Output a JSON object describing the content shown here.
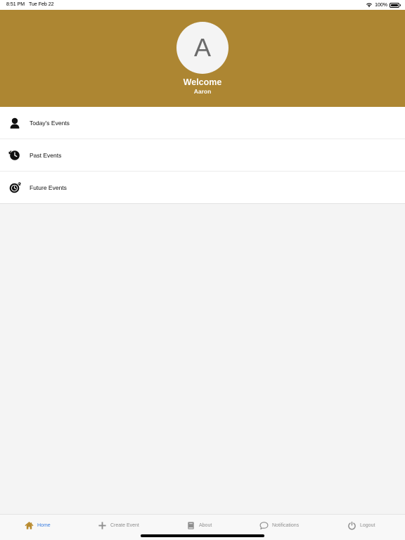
{
  "status_bar": {
    "time": "8:51 PM",
    "date": "Tue Feb 22",
    "battery": "100%",
    "icons": [
      "wifi-icon",
      "battery-icon"
    ]
  },
  "header": {
    "avatar_initial": "A",
    "welcome": "Welcome",
    "username": "Aaron",
    "background_color": "#ad8632"
  },
  "menu": {
    "items": [
      {
        "label": "Today's Events",
        "icon": "person-icon"
      },
      {
        "label": "Past Events",
        "icon": "clock-back-icon"
      },
      {
        "label": "Future Events",
        "icon": "clock-forward-icon"
      }
    ]
  },
  "tab_bar": {
    "active_color": "#3a7ee0",
    "inactive_color": "#8e8e8e",
    "tabs": [
      {
        "label": "Home",
        "icon": "home-icon",
        "active": true
      },
      {
        "label": "Create Event",
        "icon": "plus-icon",
        "active": false
      },
      {
        "label": "About",
        "icon": "book-icon",
        "active": false
      },
      {
        "label": "Notifications",
        "icon": "chat-bubble-icon",
        "active": false
      },
      {
        "label": "Logout",
        "icon": "power-icon",
        "active": false
      }
    ]
  }
}
